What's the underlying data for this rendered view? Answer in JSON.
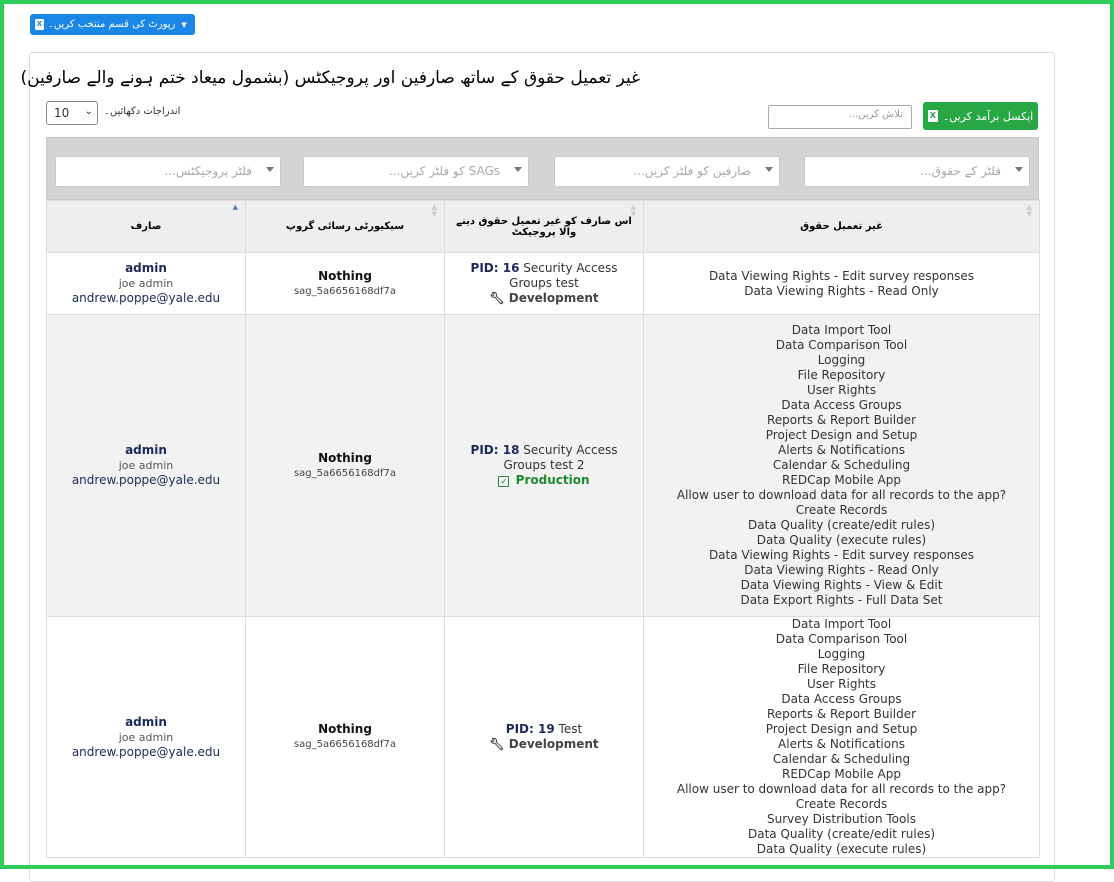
{
  "report_button": {
    "label": "رپورٹ کی قسم منتخب کریں۔"
  },
  "panel": {
    "title": "غیر تعمیل حقوق کے ساتھ صارفین اور پروجیکٹس (بشمول میعاد ختم ہونے والے صارفین)"
  },
  "length": {
    "value": "10",
    "label": "اندراجات دکھائیں۔"
  },
  "search": {
    "placeholder": "تلاش کریں..."
  },
  "excel_button": {
    "label": "ایکسل برآمد کریں۔"
  },
  "filters": {
    "projects": "فلٹر پروجیکٹس...",
    "sags": "SAGs کو فلٹر کریں...",
    "users": "صارفین کو فلٹر کریں...",
    "rights": "فلٹر کے حقوق..."
  },
  "columns": {
    "user": "صارف",
    "sag": "سیکیورٹی رسائی گروپ",
    "project": "اس صارف کو غیر تعمیل حقوق دینے والا پروجیکٹ",
    "rights": "غیر تعمیل حقوق"
  },
  "rows": [
    {
      "username": "admin",
      "fullname": "joe admin",
      "email": "andrew.poppe@yale.edu",
      "sag_name": "Nothing",
      "sag_id": "sag_5a6656168df7a",
      "pid_label": "PID:",
      "pid": "16",
      "project_title": "Security Access Groups test",
      "status": "Development",
      "rights": [
        "Data Viewing Rights - Edit survey responses",
        "Data Viewing Rights - Read Only"
      ]
    },
    {
      "username": "admin",
      "fullname": "joe admin",
      "email": "andrew.poppe@yale.edu",
      "sag_name": "Nothing",
      "sag_id": "sag_5a6656168df7a",
      "pid_label": "PID:",
      "pid": "18",
      "project_title": "Security Access Groups test 2",
      "status": "Production",
      "rights": [
        "Data Import Tool",
        "Data Comparison Tool",
        "Logging",
        "File Repository",
        "User Rights",
        "Data Access Groups",
        "Reports & Report Builder",
        "Project Design and Setup",
        "Alerts & Notifications",
        "Calendar & Scheduling",
        "REDCap Mobile App",
        "Allow user to download data for all records to the app?",
        "Create Records",
        "Data Quality (create/edit rules)",
        "Data Quality (execute rules)",
        "Data Viewing Rights - Edit survey responses",
        "Data Viewing Rights - Read Only",
        "Data Viewing Rights - View & Edit",
        "Data Export Rights - Full Data Set"
      ]
    },
    {
      "username": "admin",
      "fullname": "joe admin",
      "email": "andrew.poppe@yale.edu",
      "sag_name": "Nothing",
      "sag_id": "sag_5a6656168df7a",
      "pid_label": "PID:",
      "pid": "19",
      "project_title": "Test",
      "status": "Development",
      "rights": [
        "Data Import Tool",
        "Data Comparison Tool",
        "Logging",
        "File Repository",
        "User Rights",
        "Data Access Groups",
        "Reports & Report Builder",
        "Project Design and Setup",
        "Alerts & Notifications",
        "Calendar & Scheduling",
        "REDCap Mobile App",
        "Allow user to download data for all records to the app?",
        "Create Records",
        "Survey Distribution Tools",
        "Data Quality (create/edit rules)",
        "Data Quality (execute rules)"
      ]
    }
  ],
  "colors": {
    "frame": "#2ecc5a",
    "primary": "#1a87e6",
    "excel": "#28a745",
    "production": "#1e8a2e"
  }
}
